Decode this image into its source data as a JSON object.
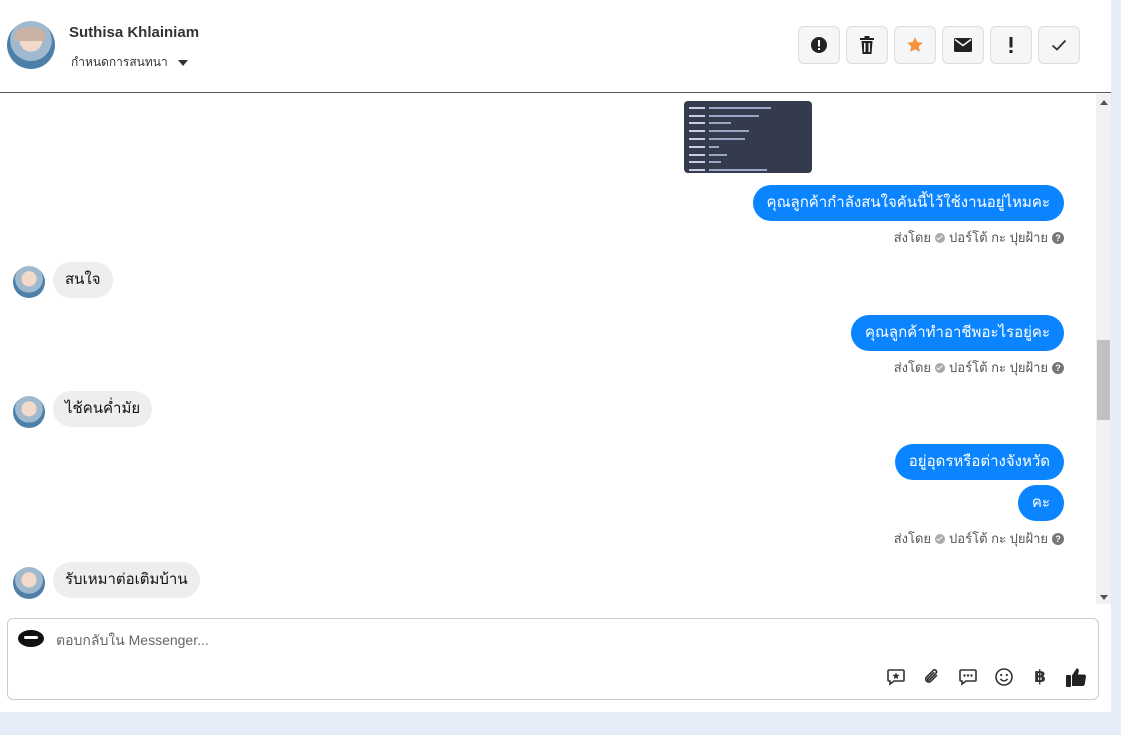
{
  "header": {
    "contact_name": "Suthisa Khlainiam",
    "assign_label": "กำหนดการสนทนา",
    "actions": [
      "alert-icon",
      "trash-icon",
      "star-icon",
      "envelope-icon",
      "exclamation-icon",
      "check-icon"
    ],
    "star_color": "#f7923a"
  },
  "messages": [
    {
      "side": "out",
      "text": "คุณลูกค้ากำลังสนใจคันนี้ไว้ใช้งานอยู่ไหมคะ"
    },
    {
      "side": "meta",
      "sent_by": "ส่งโดย",
      "agent": "ปอร์โต้ กะ ปุยฝ้าย"
    },
    {
      "side": "in",
      "text": "สนใจ"
    },
    {
      "side": "out",
      "text": "คุณลูกค้าทำอาชีพอะไรอยู่คะ"
    },
    {
      "side": "meta",
      "sent_by": "ส่งโดย",
      "agent": "ปอร์โต้ กะ ปุยฝ้าย"
    },
    {
      "side": "in",
      "text": "ไช้คนค่ำมัย"
    },
    {
      "side": "out",
      "text": "อยู่อุดรหรือต่างจังหวัด"
    },
    {
      "side": "out",
      "text": "คะ"
    },
    {
      "side": "meta",
      "sent_by": "ส่งโดย",
      "agent": "ปอร์โต้ กะ ปุยฝ้าย"
    },
    {
      "side": "in",
      "text": "รับเหมาต่อเติมบ้าน"
    }
  ],
  "composer": {
    "placeholder": "ตอบกลับใน Messenger...",
    "tools": [
      "saved-reply-icon",
      "paperclip-icon",
      "chat-bubble-icon",
      "smiley-icon",
      "baht-icon",
      "thumbs-up-icon"
    ],
    "baht_symbol": "฿"
  },
  "colors": {
    "outgoing_bubble": "#0b84ff",
    "incoming_bubble": "#eeeeee"
  }
}
